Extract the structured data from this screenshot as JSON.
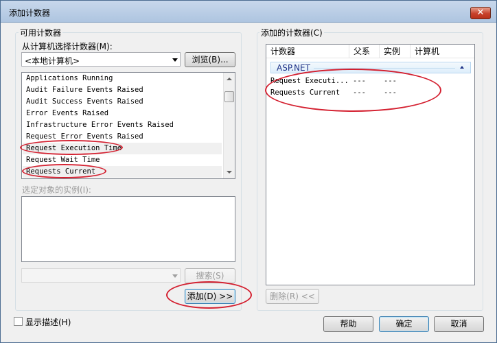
{
  "window": {
    "title": "添加计数器",
    "close_glyph": "✕"
  },
  "available": {
    "group_label": "可用计数器",
    "select_from_label": "从计算机选择计数器(M):",
    "computer_value": "<本地计算机>",
    "browse_label": "浏览(B)...",
    "counters": [
      "Applications Running",
      "Audit Failure Events Raised",
      "Audit Success Events Raised",
      "Error Events Raised",
      "Infrastructure Error Events Raised",
      "Request Error Events Raised",
      "Request Execution Time",
      "Request Wait Time",
      "Requests Current"
    ],
    "instances_label": "选定对象的实例(I):",
    "search_label": "搜索(S)",
    "add_label": "添加(D) >>"
  },
  "added": {
    "group_label": "添加的计数器(C)",
    "columns": [
      "计数器",
      "父系",
      "实例",
      "计算机"
    ],
    "group_name": "ASP.NET",
    "rows": [
      {
        "counter": "Request Executi...",
        "parent": "---",
        "instance": "---"
      },
      {
        "counter": "Requests Current",
        "parent": "---",
        "instance": "---"
      }
    ],
    "delete_label": "删除(R) <<"
  },
  "footer": {
    "show_description_label": "显示描述(H)",
    "help_label": "帮助",
    "ok_label": "确定",
    "cancel_label": "取消"
  },
  "colors": {
    "highlight_ellipse": "#d42030",
    "titlebar": "#aec5e0",
    "group_header_text": "#1e3287"
  }
}
